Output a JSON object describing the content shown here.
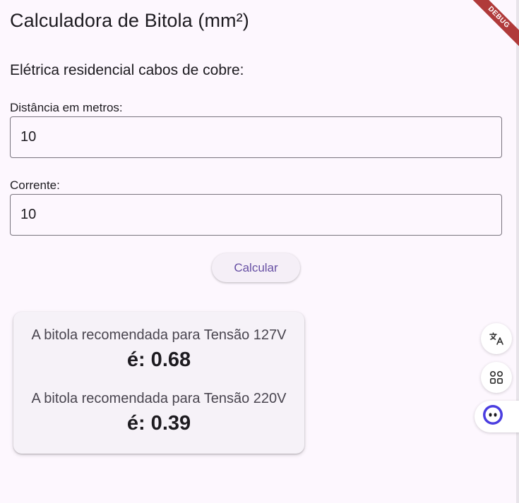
{
  "app": {
    "title": "Calculadora de Bitola (mm²)",
    "debug_label": "DEBUG"
  },
  "form": {
    "subtitle": "Elétrica residencial cabos de cobre:",
    "distance_label": "Distância em metros:",
    "distance_value": "10",
    "current_label": "Corrente:",
    "current_value": "10",
    "calculate_label": "Calcular"
  },
  "result": {
    "label_127": "A bitola recomendada para Tensão 127V",
    "value_127": "é: 0.68",
    "label_220": "A bitola recomendada para Tensão 220V",
    "value_220": "é: 0.39"
  },
  "floating_tools": {
    "icons": [
      "translate-icon",
      "apps-icon",
      "assistant-icon"
    ]
  },
  "colors": {
    "background": "#fdf7fe",
    "accent": "#6750a4",
    "card": "#f6f2f8",
    "debug_banner": "#b03a3a",
    "assistant": "#4a3de0"
  }
}
